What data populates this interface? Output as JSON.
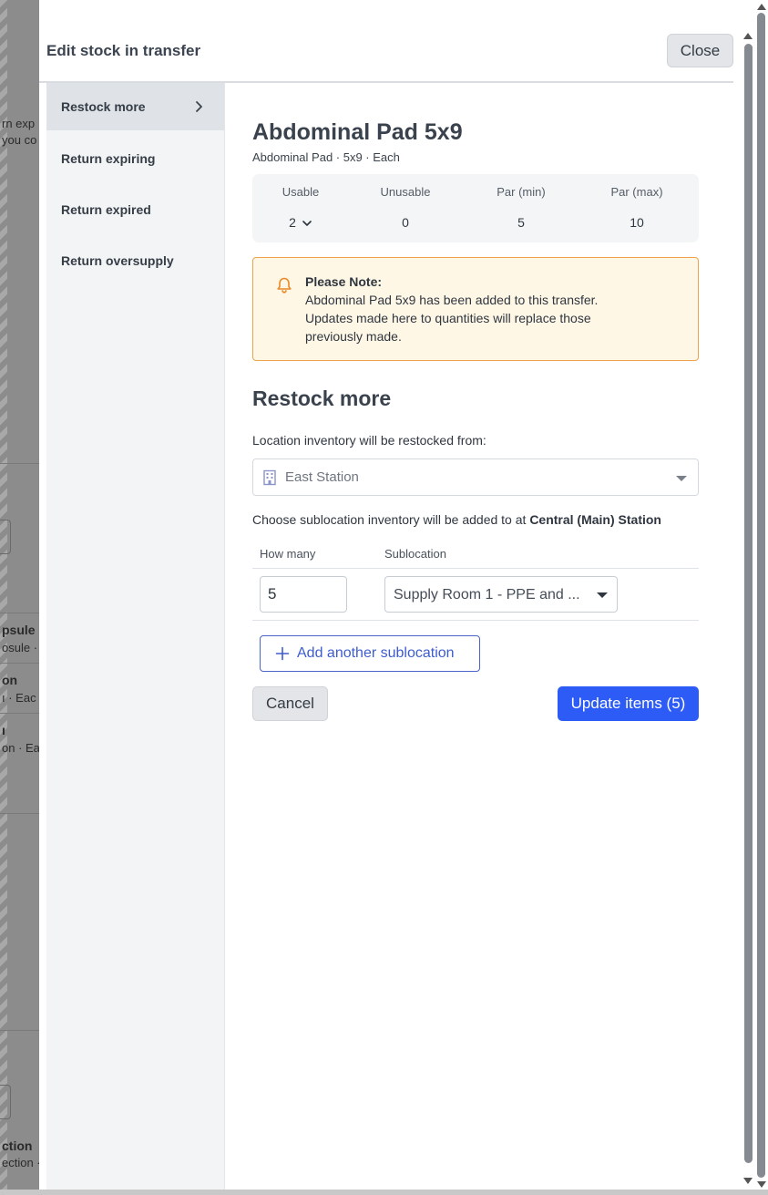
{
  "background": {
    "fragments": [
      "rn exp",
      "you co",
      "psule",
      "osule · E",
      "on",
      "ı · Eac",
      "ı",
      "on · Eac",
      "ction",
      "ection ·"
    ]
  },
  "modal": {
    "title": "Edit stock in transfer",
    "close_label": "Close"
  },
  "sidebar": {
    "items": [
      {
        "label": "Restock more",
        "active": true
      },
      {
        "label": "Return expiring",
        "active": false
      },
      {
        "label": "Return expired",
        "active": false
      },
      {
        "label": "Return oversupply",
        "active": false
      }
    ]
  },
  "item": {
    "name": "Abdominal Pad 5x9",
    "subtitle": "Abdominal Pad · 5x9 · Each"
  },
  "stats": [
    {
      "label": "Usable",
      "value": "2"
    },
    {
      "label": "Unusable",
      "value": "0"
    },
    {
      "label": "Par (min)",
      "value": "5"
    },
    {
      "label": "Par (max)",
      "value": "10"
    }
  ],
  "note": {
    "title": "Please Note:",
    "lines": [
      "Abdominal Pad 5x9 has been added to this transfer.",
      "Updates made here to quantities will replace those",
      "previously made."
    ]
  },
  "restock": {
    "section_title": "Restock more",
    "location_label": "Location inventory will be restocked from:",
    "location_value": "East Station",
    "sublocation_label_prefix": "Choose sublocation inventory will be added to at ",
    "sublocation_label_station": "Central (Main) Station",
    "columns": [
      "How many",
      "Sublocation"
    ],
    "rows": [
      {
        "quantity": "5",
        "sublocation": "Supply Room 1 - PPE and ..."
      }
    ],
    "add_label": "Add another sublocation",
    "cancel_label": "Cancel",
    "update_label": "Update items (5)"
  },
  "colors": {
    "primary": "#2d5bf5",
    "note_border": "#f0a24a",
    "note_bg": "#fff7e5",
    "outline_blue": "#3e5cd1"
  }
}
